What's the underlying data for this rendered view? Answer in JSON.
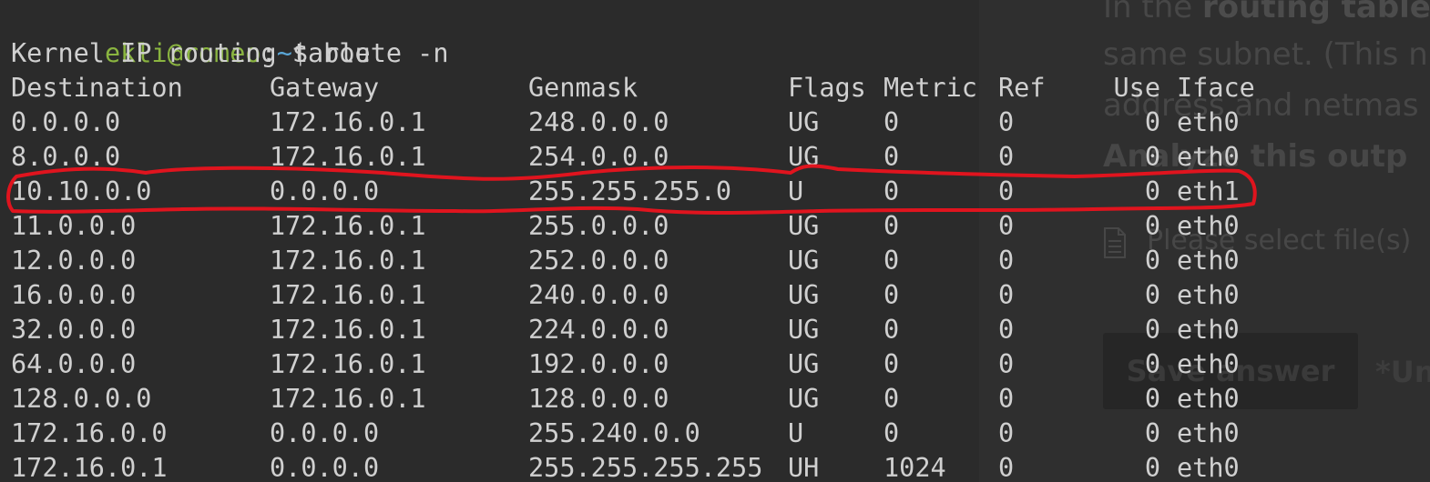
{
  "terminal": {
    "prompt": {
      "user_host": "ekli@romeo",
      "separator": ":",
      "path": "~",
      "symbol": "$",
      "command": "route -n"
    },
    "title_line": "Kernel IP routing table",
    "headers": [
      "Destination",
      "Gateway",
      "Genmask",
      "Flags",
      "Metric",
      "Ref",
      "Use",
      "Iface"
    ],
    "rows": [
      [
        "0.0.0.0",
        "172.16.0.1",
        "248.0.0.0",
        "UG",
        "0",
        "0",
        "0",
        "eth0"
      ],
      [
        "8.0.0.0",
        "172.16.0.1",
        "254.0.0.0",
        "UG",
        "0",
        "0",
        "0",
        "eth0"
      ],
      [
        "10.10.0.0",
        "0.0.0.0",
        "255.255.255.0",
        "U",
        "0",
        "0",
        "0",
        "eth1"
      ],
      [
        "11.0.0.0",
        "172.16.0.1",
        "255.0.0.0",
        "UG",
        "0",
        "0",
        "0",
        "eth0"
      ],
      [
        "12.0.0.0",
        "172.16.0.1",
        "252.0.0.0",
        "UG",
        "0",
        "0",
        "0",
        "eth0"
      ],
      [
        "16.0.0.0",
        "172.16.0.1",
        "240.0.0.0",
        "UG",
        "0",
        "0",
        "0",
        "eth0"
      ],
      [
        "32.0.0.0",
        "172.16.0.1",
        "224.0.0.0",
        "UG",
        "0",
        "0",
        "0",
        "eth0"
      ],
      [
        "64.0.0.0",
        "172.16.0.1",
        "192.0.0.0",
        "UG",
        "0",
        "0",
        "0",
        "eth0"
      ],
      [
        "128.0.0.0",
        "172.16.0.1",
        "128.0.0.0",
        "UG",
        "0",
        "0",
        "0",
        "eth0"
      ],
      [
        "172.16.0.0",
        "0.0.0.0",
        "255.240.0.0",
        "U",
        "0",
        "0",
        "0",
        "eth0"
      ],
      [
        "172.16.0.1",
        "0.0.0.0",
        "255.255.255.255",
        "UH",
        "1024",
        "0",
        "0",
        "eth0"
      ]
    ],
    "highlighted_row_index": 2
  },
  "background_page": {
    "intro_prefix": "In the ",
    "intro_bold": "routing table",
    "line2": "same subnet. (This n",
    "line3": "address and netmas",
    "analyze": "Analyze this outp",
    "file_label": "Please select file(s)",
    "save_button": "Save answer",
    "unsaved": "*Un"
  },
  "colors": {
    "background": "#2b2b2b",
    "text": "#d0d0d0",
    "prompt_user": "#8ab440",
    "prompt_path": "#5aa7d8",
    "highlight": "#e0141e"
  },
  "icons": [
    "file-icon"
  ]
}
